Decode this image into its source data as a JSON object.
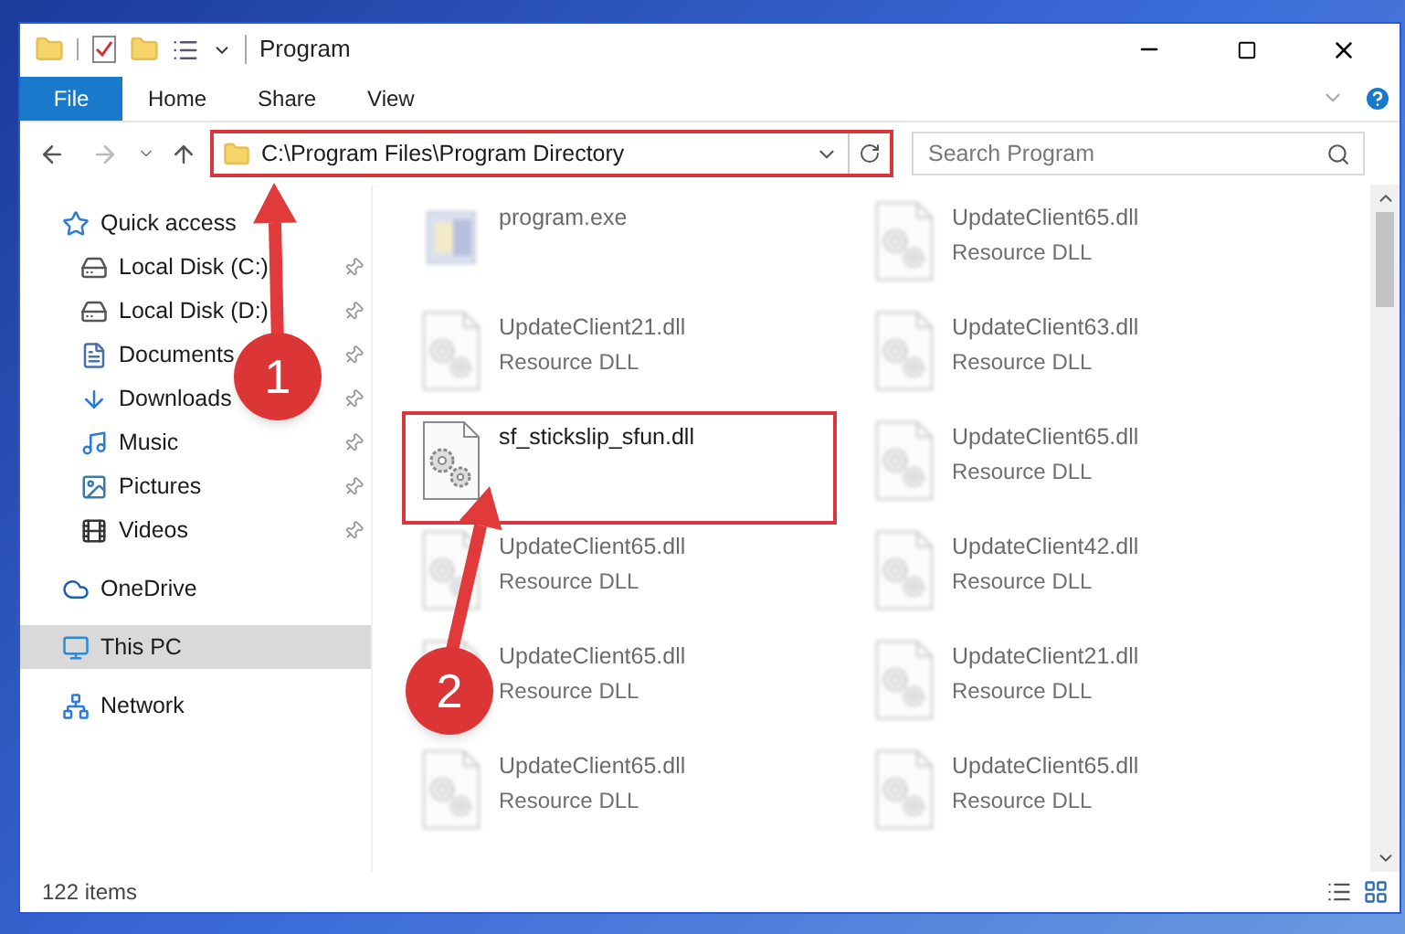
{
  "window": {
    "title": "Program"
  },
  "ribbon_tabs": [
    {
      "label": "File",
      "selected": true
    },
    {
      "label": "Home",
      "selected": false
    },
    {
      "label": "Share",
      "selected": false
    },
    {
      "label": "View",
      "selected": false
    }
  ],
  "address": {
    "path": "C:\\Program Files\\Program Directory",
    "highlighted": true
  },
  "search": {
    "placeholder": "Search Program"
  },
  "sidebar": {
    "items": [
      {
        "label": "Quick access",
        "kind": "star",
        "selected": false,
        "children": [
          {
            "label": "Local Disk (C:)",
            "kind": "system",
            "pinned": true,
            "selected": false
          },
          {
            "label": "Local Disk (D:)",
            "kind": "drive",
            "pinned": true,
            "selected": false
          },
          {
            "label": "Documents",
            "kind": "documents",
            "pinned": true,
            "selected": false
          },
          {
            "label": "Downloads",
            "kind": "downloads",
            "pinned": true,
            "selected": false
          },
          {
            "label": "Music",
            "kind": "music",
            "pinned": true,
            "selected": false
          },
          {
            "label": "Pictures",
            "kind": "pictures",
            "pinned": true,
            "selected": false
          },
          {
            "label": "Videos",
            "kind": "videos",
            "pinned": true,
            "selected": false
          }
        ]
      },
      {
        "label": "OneDrive",
        "kind": "cloud",
        "selected": false
      },
      {
        "label": "This PC",
        "kind": "pc",
        "selected": true
      },
      {
        "label": "Network",
        "kind": "network",
        "selected": false
      }
    ]
  },
  "files": [
    {
      "name": "program.exe",
      "kind": "exe",
      "blurred": true,
      "highlighted": false
    },
    {
      "name": "UpdateClient65.dll",
      "type": "Resource DLL",
      "kind": "dll",
      "blurred": true,
      "highlighted": false
    },
    {
      "name": "UpdateClient21.dll",
      "type": "Resource DLL",
      "kind": "dll",
      "blurred": true,
      "highlighted": false
    },
    {
      "name": "UpdateClient63.dll",
      "type": "Resource DLL",
      "kind": "dll",
      "blurred": true,
      "highlighted": false
    },
    {
      "name": "sf_stickslip_sfun.dll",
      "kind": "dll",
      "blurred": false,
      "highlighted": true
    },
    {
      "name": "UpdateClient65.dll",
      "type": "Resource DLL",
      "kind": "dll",
      "blurred": true,
      "highlighted": false
    },
    {
      "name": "UpdateClient65.dll",
      "type": "Resource DLL",
      "kind": "dll",
      "blurred": true,
      "highlighted": false
    },
    {
      "name": "UpdateClient42.dll",
      "type": "Resource DLL",
      "kind": "dll",
      "blurred": true,
      "highlighted": false
    },
    {
      "name": "UpdateClient65.dll",
      "type": "Resource DLL",
      "kind": "dll",
      "blurred": true,
      "highlighted": false
    },
    {
      "name": "UpdateClient21.dll",
      "type": "Resource DLL",
      "kind": "dll",
      "blurred": true,
      "highlighted": false
    },
    {
      "name": "UpdateClient65.dll",
      "type": "Resource DLL",
      "kind": "dll",
      "blurred": true,
      "highlighted": false
    },
    {
      "name": "UpdateClient65.dll",
      "type": "Resource DLL",
      "kind": "dll",
      "blurred": true,
      "highlighted": false
    }
  ],
  "status_bar": {
    "count": "122 items"
  },
  "annotations": [
    {
      "number": "1"
    },
    {
      "number": "2"
    }
  ]
}
